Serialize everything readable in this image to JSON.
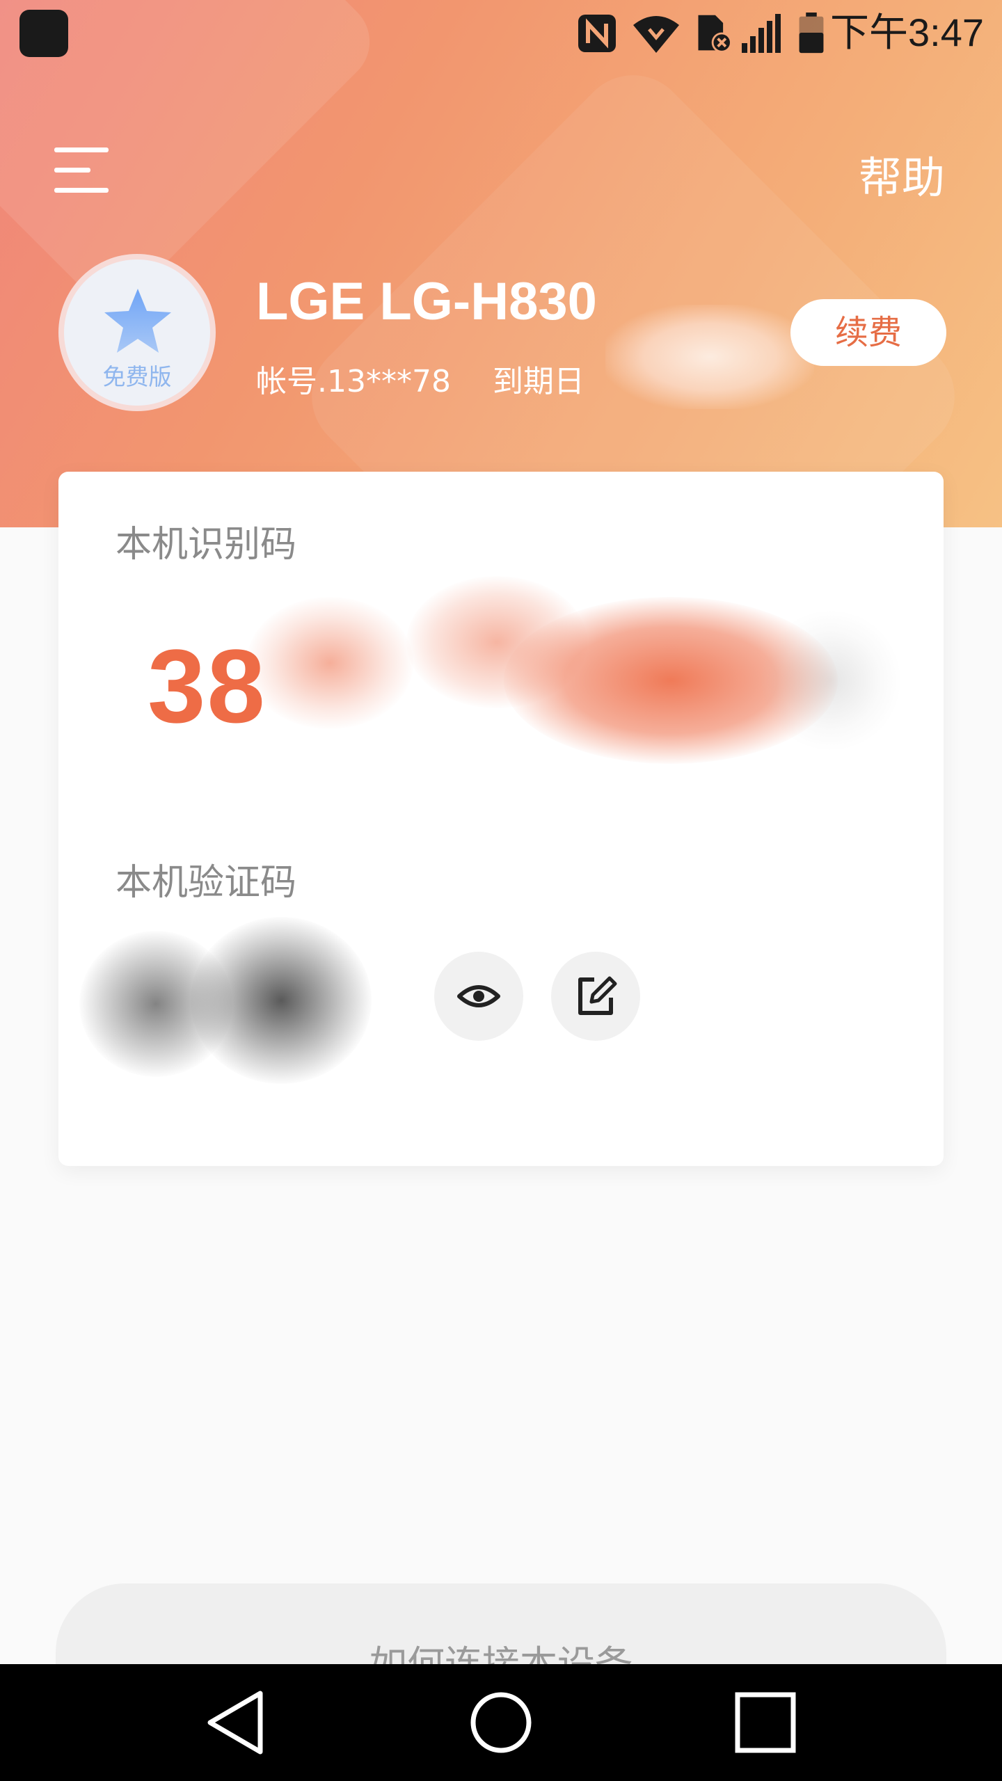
{
  "status_bar": {
    "time": "下午3:47"
  },
  "header": {
    "help_label": "帮助"
  },
  "profile": {
    "badge_label": "免费版",
    "device_name": "LGE LG-H830",
    "account": "帐号.13***78",
    "expiry_label": "到期日",
    "renew_label": "续费"
  },
  "card": {
    "device_id_label": "本机识别码",
    "device_id_visible": "38",
    "verify_code_label": "本机验证码"
  },
  "footer": {
    "connect_help": "如何连接本设备"
  },
  "colors": {
    "accent": "#ee6c46",
    "header_start": "#f0857a",
    "header_end": "#f6c184"
  },
  "icons": [
    "menu-icon",
    "star-icon",
    "eye-icon",
    "edit-icon",
    "nfc-icon",
    "wifi-icon",
    "sim-icon",
    "signal-icon",
    "battery-icon",
    "back-icon",
    "home-icon",
    "recents-icon"
  ]
}
